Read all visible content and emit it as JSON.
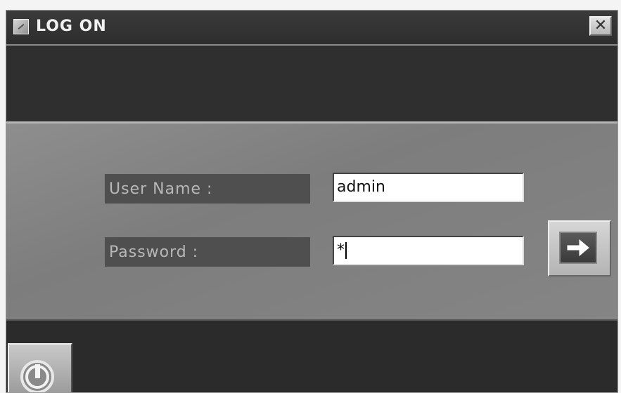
{
  "window": {
    "title": "LOG ON",
    "close_glyph": "✕"
  },
  "form": {
    "user_label": "User Name :",
    "user_value": "admin",
    "password_label": "Password :",
    "password_value": "*"
  },
  "icons": {
    "app": "app-icon",
    "close": "close-icon",
    "submit": "arrow-right-icon",
    "power": "power-icon"
  }
}
